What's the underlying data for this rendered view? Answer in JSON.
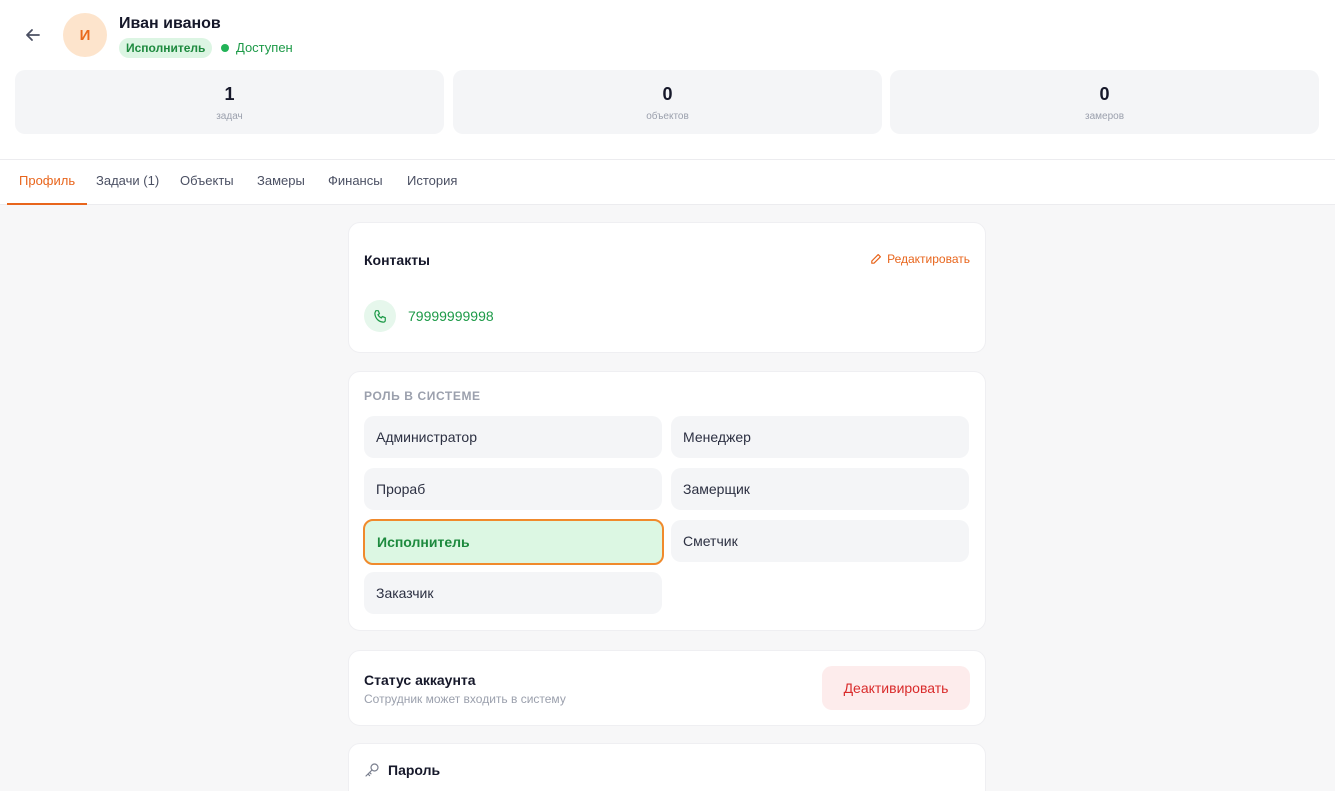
{
  "header": {
    "avatar_initial": "И",
    "name": "Иван иванов",
    "role_badge": "Исполнитель",
    "availability": "Доступен",
    "back_icon": "arrow-left-icon"
  },
  "stats": [
    {
      "value": "1",
      "label": "задач"
    },
    {
      "value": "0",
      "label": "объектов"
    },
    {
      "value": "0",
      "label": "замеров"
    }
  ],
  "tabs": [
    {
      "label": "Профиль",
      "active": true
    },
    {
      "label": "Задачи (1)",
      "active": false
    },
    {
      "label": "Объекты",
      "active": false
    },
    {
      "label": "Замеры",
      "active": false
    },
    {
      "label": "Финансы",
      "active": false
    },
    {
      "label": "История",
      "active": false
    }
  ],
  "contacts": {
    "title": "Контакты",
    "edit_label": "Редактировать",
    "phone": "79999999998"
  },
  "roles": {
    "caption": "РОЛЬ В СИСТЕМЕ",
    "options": [
      {
        "label": "Администратор"
      },
      {
        "label": "Менеджер"
      },
      {
        "label": "Прораб"
      },
      {
        "label": "Замерщик"
      },
      {
        "label": "Исполнитель",
        "selected": true
      },
      {
        "label": "Сметчик"
      },
      {
        "label": "Заказчик"
      }
    ]
  },
  "account_status": {
    "title": "Статус аккаунта",
    "description": "Сотрудник может входить в систему",
    "button": "Деактивировать"
  },
  "password": {
    "title": "Пароль"
  },
  "colors": {
    "accent": "#e8651c",
    "success": "#1d9a48",
    "danger": "#d92b2b",
    "selected_border": "#f08a2c"
  }
}
